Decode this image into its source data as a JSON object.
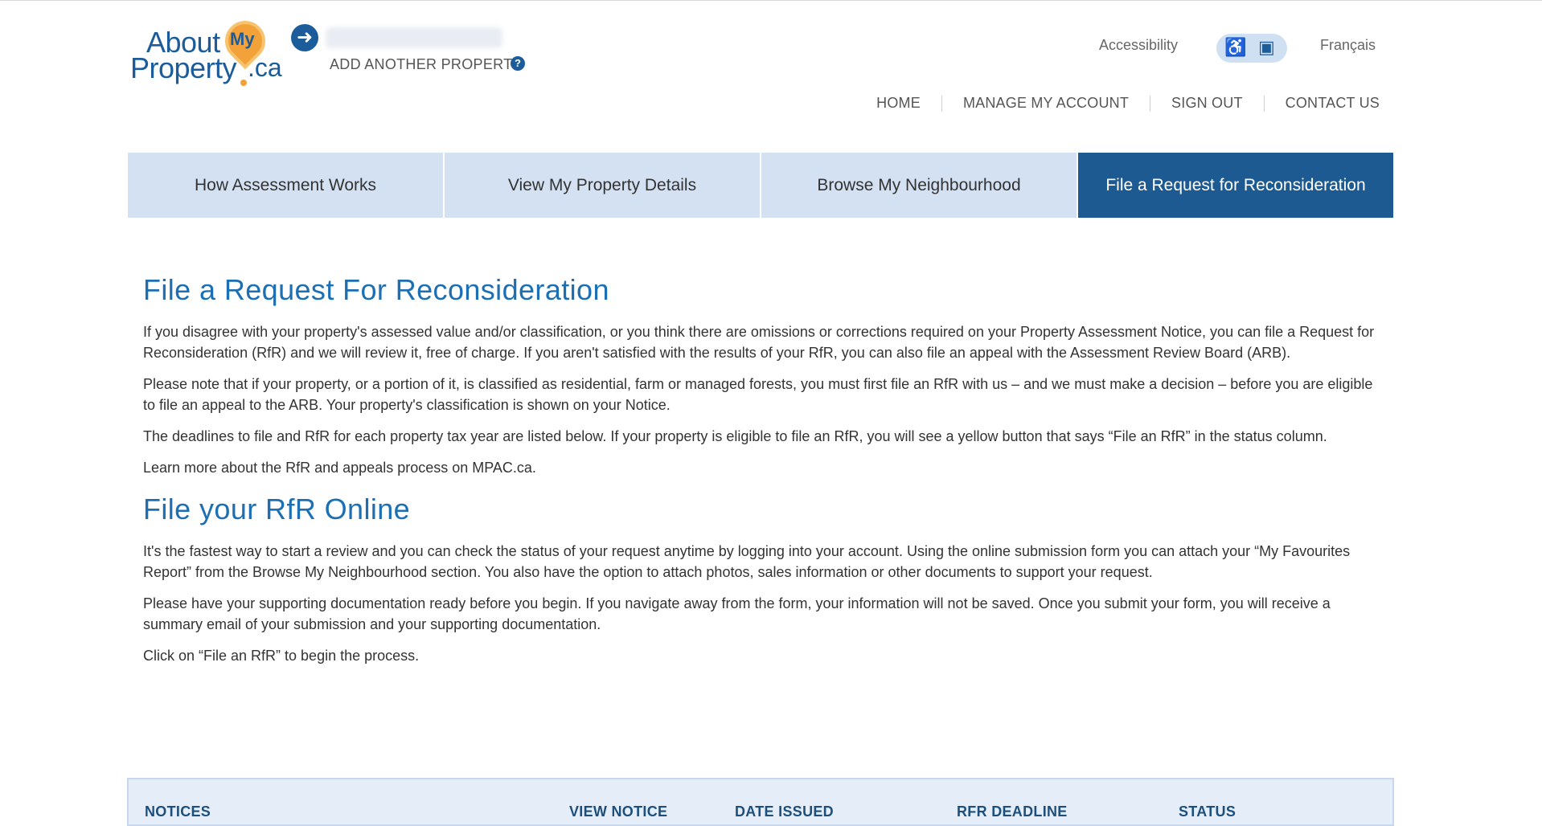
{
  "logo": {
    "about": "About",
    "my": "My",
    "property": "Property",
    "ca": ".ca"
  },
  "header": {
    "add_property": "ADD ANOTHER PROPERTY",
    "accessibility": "Accessibility",
    "language": "Français"
  },
  "topnav": [
    "HOME",
    "MANAGE MY ACCOUNT",
    "SIGN OUT",
    "CONTACT US"
  ],
  "tabs": [
    {
      "label": "How Assessment Works",
      "active": false
    },
    {
      "label": "View My Property Details",
      "active": false
    },
    {
      "label": "Browse My Neighbourhood",
      "active": false
    },
    {
      "label": "File a Request for Reconsideration",
      "active": true
    }
  ],
  "section1": {
    "title": "File a Request For Reconsideration",
    "paragraphs": [
      "If you disagree with your property's assessed value and/or classification, or you think there are omissions or corrections required on your Property Assessment Notice, you can file a Request for Reconsideration (RfR) and we will review it, free of charge. If you aren't satisfied with the results of your RfR, you can also file an appeal with the Assessment Review Board (ARB).",
      "Please note that if your property, or a portion of it, is classified as residential, farm or managed forests, you must first file an RfR with us – and we must make a decision – before you are eligible to file an appeal to the ARB. Your property's classification is shown on your Notice.",
      "The deadlines to file and RfR for each property tax year are listed below. If your property is eligible to file an RfR, you will see a yellow button that says “File an RfR” in the status column.",
      "Learn more about the RfR and appeals process on MPAC.ca."
    ]
  },
  "section2": {
    "title": "File your RfR Online",
    "paragraphs": [
      "It's the fastest way to start a review and you can check the status of your request anytime by logging into your account. Using the online submission form you can attach your “My Favourites Report” from the Browse My Neighbourhood section. You also have the option to attach photos, sales information or other documents to support your request.",
      "Please have your supporting documentation ready before you begin. If you navigate away from the form, your information will not be saved. Once you submit your form, you will receive a summary email of your submission and your supporting documentation.",
      "Click on “File an RfR” to begin the process."
    ]
  },
  "table": {
    "columns": [
      "NOTICES",
      "VIEW NOTICE",
      "DATE ISSUED",
      "RFR DEADLINE",
      "STATUS"
    ]
  }
}
